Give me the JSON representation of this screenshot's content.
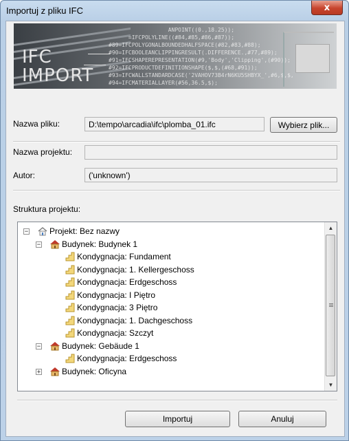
{
  "window": {
    "title": "Importuj z pliku IFC",
    "close_glyph": "x"
  },
  "banner": {
    "logo_line1": "IFC",
    "logo_line2": "IMPORT",
    "code_lines": [
      "                  ANPOINT((0.,18.25));",
      "      =IFCPOLYLINE((#84,#85,#86,#87));",
      "#89=IFCPOLYGONALBOUNDEDHALFSPACE(#82,#83,#88);",
      "#90=IFCBOOLEANCLIPPINGRESULT(.DIFFERENCE.,#77,#89);",
      "#91=IFCSHAPEREPRESENTATION(#9,'Body','Clipping',(#90));",
      "#92=IFCPRODUCTDEFINITIONSHAPE($,$,(#68,#91));",
      "#93=IFCWALLSTANDARDCASE('2VAHOV73B4rN6KU5SHBYX_',#6,$,$,",
      "#94=IFCMATERIALLAYER(#56,36.5,$);"
    ]
  },
  "form": {
    "file_label": "Nazwa pliku:",
    "file_value": "D:\\tempo\\arcadia\\ifc\\plomba_01.ifc",
    "choose_file_button": "Wybierz plik...",
    "project_name_label": "Nazwa projektu:",
    "project_name_value": "",
    "author_label": "Autor:",
    "author_value": "('unknown')",
    "structure_label": "Struktura projektu:"
  },
  "tree": [
    {
      "level": 0,
      "expander": "−",
      "icon": "project-icon",
      "label": "Projekt: Bez nazwy"
    },
    {
      "level": 1,
      "expander": "−",
      "icon": "building-icon",
      "label": "Budynek: Budynek 1"
    },
    {
      "level": 2,
      "expander": "",
      "icon": "floor-icon",
      "label": "Kondygnacja: Fundament"
    },
    {
      "level": 2,
      "expander": "",
      "icon": "floor-icon",
      "label": "Kondygnacja: 1. Kellergeschoss"
    },
    {
      "level": 2,
      "expander": "",
      "icon": "floor-icon",
      "label": "Kondygnacja: Erdgeschoss"
    },
    {
      "level": 2,
      "expander": "",
      "icon": "floor-icon",
      "label": "Kondygnacja: I Piętro"
    },
    {
      "level": 2,
      "expander": "",
      "icon": "floor-icon",
      "label": "Kondygnacja: 3 Piętro"
    },
    {
      "level": 2,
      "expander": "",
      "icon": "floor-icon",
      "label": "Kondygnacja: 1. Dachgeschoss"
    },
    {
      "level": 2,
      "expander": "",
      "icon": "floor-icon",
      "label": "Kondygnacja: Szczyt"
    },
    {
      "level": 1,
      "expander": "−",
      "icon": "building-icon",
      "label": "Budynek: Gebäude 1"
    },
    {
      "level": 2,
      "expander": "",
      "icon": "floor-icon",
      "label": "Kondygnacja: Erdgeschoss"
    },
    {
      "level": 1,
      "expander": "+",
      "icon": "building-icon",
      "label": "Budynek: Oficyna"
    }
  ],
  "buttons": {
    "import": "Importuj",
    "cancel": "Anuluj"
  }
}
